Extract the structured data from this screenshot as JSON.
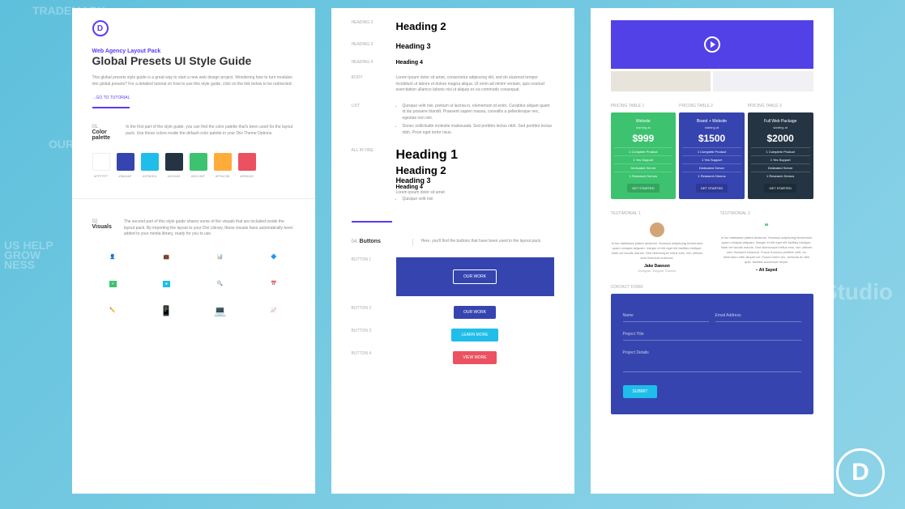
{
  "bg": {
    "trademark": "TRADEMARK",
    "partners": "OUR PART",
    "help": "US HELP",
    "grow": "GROW",
    "ness": "NESS",
    "studio": "Studio"
  },
  "panel1": {
    "subtitle": "Web Agency Layout Pack",
    "title": "Global Presets UI Style Guide",
    "desc": "This global presets style guide is a great way to start a new web design project. Wondering how to turn modules into global presets? For a detailed tutorial on how to use this style guide, click on the link below to be redirected.",
    "tutorial": "→GO TO TUTORIAL",
    "s1num": "01.",
    "s1title": "Color palette",
    "s1text": "In the first part of the style guide, you can find the color palette that's been used for the layout pack. Use these colors inside the default color palette in your Divi Theme Options.",
    "colors": [
      {
        "hex": "#FFFFFF",
        "code": "#FFFFFF"
      },
      {
        "hex": "#3644AF",
        "code": "#3644AF"
      },
      {
        "hex": "#1FBDEA",
        "code": "#1FBDEA"
      },
      {
        "hex": "#243443",
        "code": "#243443"
      },
      {
        "hex": "#3DC36F",
        "code": "#3DC36F"
      },
      {
        "hex": "#FFAC3B",
        "code": "#FFAC3B"
      },
      {
        "hex": "#EB5160",
        "code": "#EB5160"
      }
    ],
    "s2num": "02.",
    "s2title": "Visuals",
    "s2text": "The second part of this style guide shares some of the visuals that are included inside the layout pack. By importing the layout to your Divi Library, these visuals have automatically been added to your media library, ready for you to use."
  },
  "panel2": {
    "labels": {
      "h2": "HEADING 2",
      "h3": "HEADING 3",
      "h4": "HEADING 4",
      "body": "BODY",
      "list": "LIST",
      "all": "ALL IN ONE",
      "b1": "BUTTON 1",
      "b2": "BUTTON 2",
      "b3": "BUTTON 3",
      "b4": "BUTTON 4"
    },
    "h1": "Heading 1",
    "h2": "Heading 2",
    "h3": "Heading 3",
    "h4": "Heading 4",
    "body": "Lorem ipsum dolor sit amet, consectetur adipiscing elit, sed do eiusmod tempor incididunt ut labore et dolore magna aliqua. Ut enim ad minim veniam, quis nostrud exercitation ullamco laboris nisi ut aliquip ex ea commodo consequat.",
    "list1": "Quisque velit nisi, pretium ut lacinia in, elementum id enim. Curabitur aliquet quam id dui posuere blandit. Praesent sapien massa, convallis a pellentesque nec, egestas non nisi.",
    "list2": "Donec sollicitudin molestie malesuada. Sed porttitor lectus nibh. Sed porttitor lectus nibh. Proin eget tortor risus.",
    "lorem1": "Lorem ipsum dolor sit amet",
    "lorem2": "Quisque velit nisi",
    "s4num": "04.",
    "s4title": "Buttons",
    "s4text": "Here, you'll find the buttons that have been used in the layout pack.",
    "btn1": "OUR WORK",
    "btn2": "OUR WORK",
    "btn3": "LEARN MORE",
    "btn4": "VIEW MORE"
  },
  "panel3": {
    "plabels": {
      "p1": "PRICING TABLE 1",
      "p2": "PRICING TABLE 2",
      "p3": "PRICING TABLE 3"
    },
    "pricing": [
      {
        "title": "Website",
        "sub": "starting at",
        "price": "$999",
        "feat": [
          "1 Complete Product",
          "1 Yes Support",
          "Dedicated Server",
          "1 Research Demos"
        ],
        "btn": "GET STARTED",
        "bg": "#3DC36F"
      },
      {
        "title": "Brand + Website",
        "sub": "starting at",
        "price": "$1500",
        "feat": [
          "1 Complete Product",
          "1 Yes Support",
          "Dedicated Server",
          "1 Research Demos"
        ],
        "btn": "GET STARTED",
        "bg": "#3644AF"
      },
      {
        "title": "Full Web Package",
        "sub": "starting at",
        "price": "$2000",
        "feat": [
          "1 Complete Product",
          "1 Yes Support",
          "Dedicated Server",
          "1 Research Demos"
        ],
        "btn": "GET STARTED",
        "bg": "#243443"
      }
    ],
    "tlabels": {
      "t1": "TESTIMONIAL 1",
      "t2": "TESTIMONIAL 2"
    },
    "test1": {
      "text": "In fac habitasse platea dictumst. Vivamus adipiscing fermentum quam volutpat aliquam. Integer et elit eget elit facilisis tristique. Nam vel iaculis mauris. Sed ullamcorper tellus erat, non ultrices sem tincidunt euismod.",
      "name": "Jake Dawson",
      "role": "Designer, Elegant Themes"
    },
    "test2": {
      "text": "In fac habitasse platea dictumst. Vivamus adipiscing fermentum quam volutpat aliquam. Integer et elit eget elit facilisis tristique. Nam vel iaculis mauris. Sed ullamcorper tellus erat, non ultrices sem tincidunt euismod. Fusce rhoncus porttitor velit, eu bibendum nibh aliquet vel. Fusce lorem leo, vehicula at nibh quis, facilisis accumsan turpis.",
      "name": "– Ali Sayed"
    },
    "formlabel": "CONTACT FORM",
    "form": {
      "name": "Name",
      "email": "Email Address",
      "project": "Project Title",
      "details": "Project Details",
      "submit": "SUBMIT"
    }
  }
}
